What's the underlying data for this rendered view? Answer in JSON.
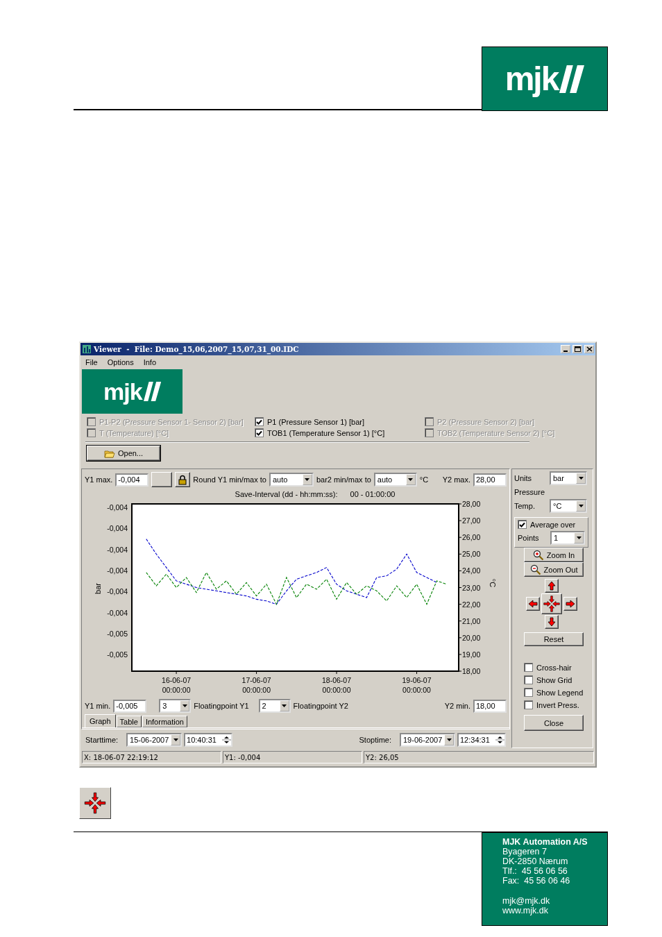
{
  "header": {
    "logo": "mjk"
  },
  "window": {
    "title": "Viewer  -  File: Demo_15,06,2007_15,07,31_00.IDC",
    "menu": [
      "File",
      "Options",
      "Info"
    ],
    "logo": "mjk",
    "channels": [
      {
        "label": "P1-P2 (Pressure Sensor 1- Sensor 2) [bar]",
        "checked": false,
        "disabled": true
      },
      {
        "label": "P1 (Pressure Sensor 1) [bar]",
        "checked": true,
        "disabled": false
      },
      {
        "label": "P2 (Pressure Sensor 2) [bar]",
        "checked": false,
        "disabled": true
      },
      {
        "label": "T (Temperature) [°C]",
        "checked": false,
        "disabled": true
      },
      {
        "label": "TOB1 (Temperature Sensor 1) [°C]",
        "checked": true,
        "disabled": false
      },
      {
        "label": "TOB2 (Temperature Sensor 2) [°C]",
        "checked": false,
        "disabled": true
      }
    ],
    "open_button": "Open...",
    "graph_panel": {
      "y1_max": {
        "label": "Y1 max.",
        "value": "-0,004"
      },
      "round_y1": {
        "label": "Round Y1 min/max to",
        "value": "auto"
      },
      "round_y2": {
        "label": "bar2 min/max to",
        "value": "auto",
        "unit": "°C"
      },
      "y2_max": {
        "label": "Y2 max.",
        "value": "28,00"
      },
      "save_interval": {
        "label": "Save-Interval  (dd -  hh:mm:ss):",
        "value": "00 - 01:00:00"
      },
      "left_axis": {
        "label": "bar",
        "ticks": [
          "-0,004",
          "-0,004",
          "-0,004",
          "-0,004",
          "-0,004",
          "-0,004",
          "-0,005",
          "-0,005"
        ]
      },
      "chart_data": {
        "type": "line",
        "ylabel": "°C",
        "ylim": [
          18,
          28
        ],
        "categories": [
          null,
          null,
          null,
          null,
          "16-06-07 00:00:00",
          null,
          null,
          null,
          null,
          null,
          null,
          null,
          "17-06-07 00:00:00",
          null,
          null,
          null,
          null,
          null,
          null,
          null,
          "18-06-07 00:00:00",
          null,
          null,
          null,
          null,
          null,
          null,
          null,
          "19-06-07 00:00:00",
          null,
          null,
          null,
          null
        ],
        "yticks": [
          {
            "value": 28,
            "label": "28,00"
          },
          {
            "value": 27,
            "label": "27,00"
          },
          {
            "value": 26,
            "label": "26,00"
          },
          {
            "value": 25,
            "label": "25,00"
          },
          {
            "value": 24,
            "label": "24,00"
          },
          {
            "value": 23,
            "label": "23,00"
          },
          {
            "value": 22,
            "label": "22,00"
          },
          {
            "value": 21,
            "label": "21,00"
          },
          {
            "value": 20,
            "label": "20,00"
          },
          {
            "value": 19,
            "label": "19,00"
          },
          {
            "value": 18,
            "label": "18,00"
          }
        ],
        "series": [
          {
            "color": "#0000cc",
            "line_style": "dashed",
            "values": [
              null,
              25.9,
              25.0,
              24.2,
              23.4,
              23.2,
              23.0,
              22.9,
              22.8,
              22.7,
              22.6,
              22.5,
              22.3,
              22.2,
              22.0,
              22.8,
              23.5,
              23.7,
              23.9,
              24.2,
              23.2,
              22.8,
              22.6,
              22.4,
              23.6,
              23.7,
              24.1,
              25.0,
              23.9,
              23.6,
              23.3,
              null,
              null
            ]
          },
          {
            "color": "#008000",
            "line_style": "dashed",
            "values": [
              null,
              23.9,
              23.1,
              23.8,
              23.0,
              23.6,
              22.7,
              23.9,
              22.9,
              23.4,
              22.6,
              23.3,
              22.5,
              23.2,
              22.0,
              23.6,
              22.4,
              23.2,
              22.9,
              23.5,
              22.3,
              23.3,
              22.6,
              23.1,
              22.8,
              22.2,
              23.1,
              22.4,
              23.2,
              22.0,
              23.4,
              23.2,
              null
            ]
          }
        ]
      },
      "y1_min": {
        "label": "Y1 min.",
        "value": "-0,005"
      },
      "floatingpoint_y1": {
        "value": "3",
        "label": "Floatingpoint Y1"
      },
      "floatingpoint_y2": {
        "value": "2",
        "label": "Floatingpoint Y2"
      },
      "y2_min": {
        "label": "Y2 min.",
        "value": "18,00"
      }
    },
    "tabs": [
      {
        "label": "Graph",
        "selected": true
      },
      {
        "label": "Table",
        "selected": false
      },
      {
        "label": "Information",
        "selected": false
      }
    ],
    "starttime": {
      "label": "Starttime:",
      "date": "15-06-2007",
      "time": "10:40:31"
    },
    "stoptime": {
      "label": "Stoptime:",
      "date": "19-06-2007",
      "time": "12:34:31"
    },
    "side_panel": {
      "units_label": "Units",
      "pressure_label": "Pressure",
      "pressure_unit": "bar",
      "temp_label": "Temp.",
      "temp_unit": "°C",
      "average": {
        "label": "Average over",
        "checked": true
      },
      "points": {
        "label": "Points",
        "value": "1"
      },
      "zoom_in": "Zoom In",
      "zoom_out": "Zoom Out",
      "reset": "Reset",
      "options": [
        {
          "label": "Cross-hair",
          "checked": false
        },
        {
          "label": "Show Grid",
          "checked": false
        },
        {
          "label": "Show Legend",
          "checked": false
        },
        {
          "label": "Invert Press.",
          "checked": false
        }
      ],
      "close": "Close"
    },
    "status_bar": [
      "X: 18-06-07 22:19:12",
      "Y1: -0,004",
      "Y2: 26,05"
    ]
  },
  "footer": {
    "company": "MJK Automation A/S",
    "lines": [
      "Byageren 7",
      "DK-2850 Nærum",
      "Tlf.:  45 56 06 56",
      "Fax:  45 56 06 46"
    ],
    "links": [
      "mjk@mjk.dk",
      "www.mjk.dk"
    ]
  }
}
